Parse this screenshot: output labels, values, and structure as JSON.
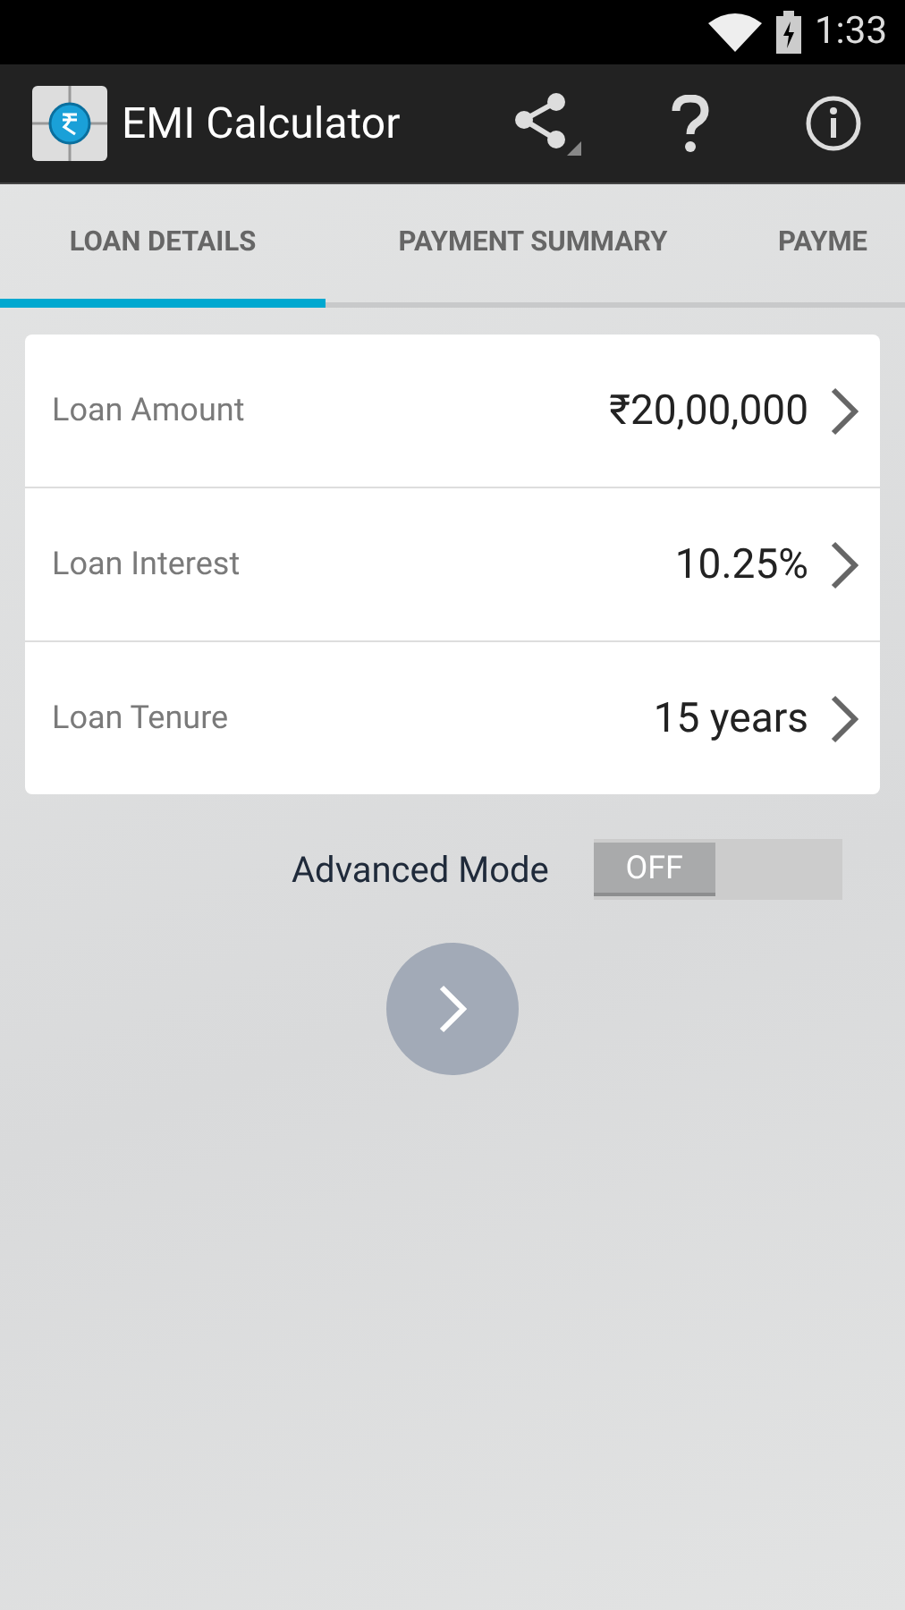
{
  "status_bar": {
    "time": "1:33"
  },
  "app_bar": {
    "title": "EMI Calculator"
  },
  "tabs": [
    {
      "label": "LOAN DETAILS",
      "selected": true
    },
    {
      "label": "PAYMENT SUMMARY",
      "selected": false
    },
    {
      "label": "PAYME",
      "selected": false
    }
  ],
  "fields": [
    {
      "label": "Loan Amount",
      "value": "₹20,00,000"
    },
    {
      "label": "Loan Interest",
      "value": "10.25%"
    },
    {
      "label": "Loan Tenure",
      "value": "15 years"
    }
  ],
  "advanced_mode": {
    "label": "Advanced Mode",
    "on": false,
    "state_text": "OFF"
  }
}
